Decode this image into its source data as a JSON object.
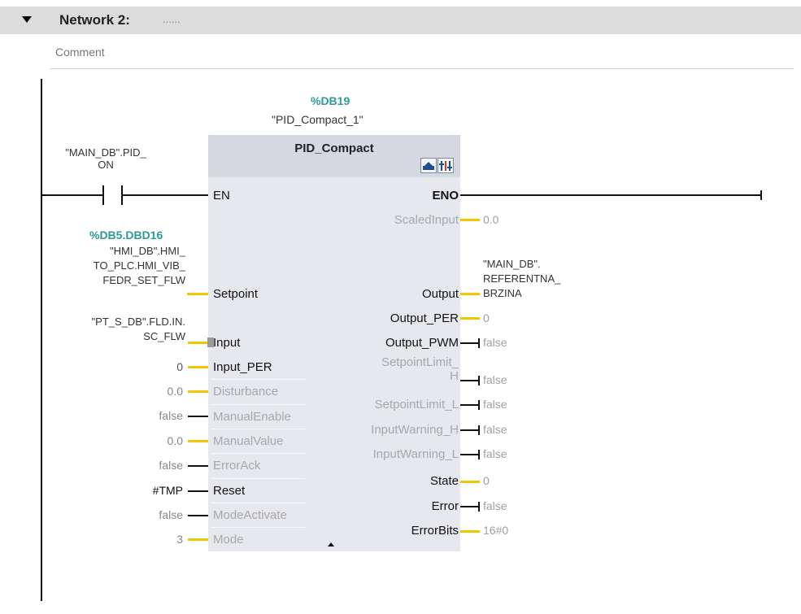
{
  "network": {
    "title": "Network 2:",
    "dots": "......",
    "comment": "Comment"
  },
  "instance": {
    "address": "%DB19",
    "name": "\"PID_Compact_1\""
  },
  "block": {
    "type": "PID_Compact"
  },
  "contact": {
    "tag_line1": "\"MAIN_DB\".PID_",
    "tag_line2": "ON"
  },
  "setpoint_tag": {
    "address": "%DB5.DBD16",
    "line1": "\"HMI_DB\".HMI_",
    "line2": "TO_PLC.HMI_VIB_",
    "line3": "FEDR_SET_FLW"
  },
  "input_tag": {
    "line1": "\"PT_S_DB\".FLD.IN.",
    "line2": "SC_FLW"
  },
  "output_tag": {
    "line1": "\"MAIN_DB\".",
    "line2": "REFERENTNA_",
    "line3": "BRZINA"
  },
  "pins_in": {
    "en": "EN",
    "setpoint": "Setpoint",
    "input": "Input",
    "input_per": "Input_PER",
    "disturbance": "Disturbance",
    "manual_enable": "ManualEnable",
    "manual_value": "ManualValue",
    "error_ack": "ErrorAck",
    "reset": "Reset",
    "mode_activate": "ModeActivate",
    "mode": "Mode"
  },
  "pins_out": {
    "eno": "ENO",
    "scaled_input": "ScaledInput",
    "output": "Output",
    "output_per": "Output_PER",
    "output_pwm": "Output_PWM",
    "sp_limit_h_1": "SetpointLimit_",
    "sp_limit_h_2": "H",
    "sp_limit_l": "SetpointLimit_L",
    "input_warning_h": "InputWarning_H",
    "input_warning_l": "InputWarning_L",
    "state": "State",
    "error": "Error",
    "error_bits": "ErrorBits"
  },
  "values_in": {
    "input_per": "0",
    "disturbance": "0.0",
    "manual_enable": "false",
    "manual_value": "0.0",
    "error_ack": "false",
    "reset": "#TMP",
    "mode_activate": "false",
    "mode": "3"
  },
  "values_out": {
    "scaled_input": "0.0",
    "output_per": "0",
    "output_pwm": "false",
    "sp_limit_h": "false",
    "sp_limit_l": "false",
    "input_warning_h": "false",
    "input_warning_l": "false",
    "state": "0",
    "error": "false",
    "error_bits": "16#0"
  },
  "colors": {
    "header_bg": "#dcdcdc",
    "block_bg": "#e6e8ee",
    "address": "#2a9a9a",
    "analog_wire": "#f3c400"
  }
}
